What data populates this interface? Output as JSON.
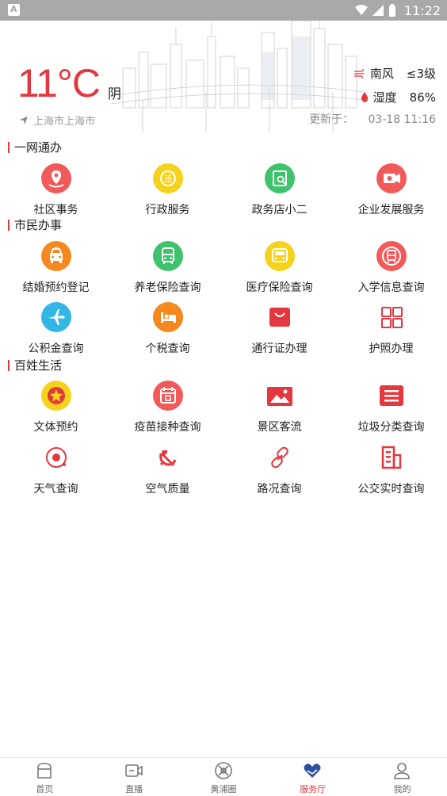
{
  "status_bar": {
    "time": "11:22"
  },
  "weather": {
    "temperature": "11°C",
    "condition": "阴",
    "location": "上海市上海市",
    "wind_label": "南风",
    "wind_value": "≤3级",
    "humidity_label": "湿度",
    "humidity_value": "86%",
    "update_label": "更新于：",
    "update_time": "03-18 11:16"
  },
  "sections": [
    {
      "title": "一网通办",
      "items": [
        {
          "label": "社区事务",
          "icon": "community-icon",
          "color": "#f25a5a"
        },
        {
          "label": "行政服务",
          "icon": "admin-service-icon",
          "color": "#f7d21c"
        },
        {
          "label": "政务店小二",
          "icon": "gov-assistant-icon",
          "color": "#3ec26b"
        },
        {
          "label": "企业发展服务",
          "icon": "enterprise-icon",
          "color": "#f25a5a"
        }
      ]
    },
    {
      "title": "市民办事",
      "items": [
        {
          "label": "结婚预约登记",
          "icon": "taxi-icon",
          "color": "#f5881f"
        },
        {
          "label": "养老保险查询",
          "icon": "bus-icon",
          "color": "#3ec26b"
        },
        {
          "label": "医疗保险查询",
          "icon": "bus-front-icon",
          "color": "#f7d21c"
        },
        {
          "label": "入学信息查询",
          "icon": "subway-icon",
          "color": "#f25a5a"
        },
        {
          "label": "公积金查询",
          "icon": "airplane-icon",
          "color": "#31b6e6"
        },
        {
          "label": "个税查询",
          "icon": "hotel-bed-icon",
          "color": "#f5881f"
        },
        {
          "label": "通行证办理",
          "icon": "shopping-bag-icon",
          "color": "#e3383f"
        },
        {
          "label": "护照办理",
          "icon": "grid-apps-icon",
          "color": "#e3383f"
        }
      ]
    },
    {
      "title": "百姓生活",
      "items": [
        {
          "label": "文体预约",
          "icon": "star-badge-icon",
          "color": "#f7d21c"
        },
        {
          "label": "疫苗接种查询",
          "icon": "calendar-icon",
          "color": "#f25a5a"
        },
        {
          "label": "景区客流",
          "icon": "image-icon",
          "color": "#e3383f"
        },
        {
          "label": "垃圾分类查询",
          "icon": "list-icon",
          "color": "#e3383f"
        },
        {
          "label": "天气查询",
          "icon": "target-icon",
          "color": "#e3383f"
        },
        {
          "label": "空气质量",
          "icon": "hammer-sickle-icon",
          "color": "#e3383f"
        },
        {
          "label": "路况查询",
          "icon": "link-icon",
          "color": "#e3383f"
        },
        {
          "label": "公交实时查询",
          "icon": "building-icon",
          "color": "#e3383f"
        }
      ]
    }
  ],
  "bottom_nav": [
    {
      "label": "首页",
      "icon": "home-icon",
      "active": false
    },
    {
      "label": "直播",
      "icon": "video-icon",
      "active": false
    },
    {
      "label": "黄浦圈",
      "icon": "compass-icon",
      "active": false
    },
    {
      "label": "服务厅",
      "icon": "heart-hands-icon",
      "active": true
    },
    {
      "label": "我的",
      "icon": "user-icon",
      "active": false
    }
  ],
  "colors": {
    "accent": "#e3383f",
    "status_bar": "#a9a9a9"
  }
}
